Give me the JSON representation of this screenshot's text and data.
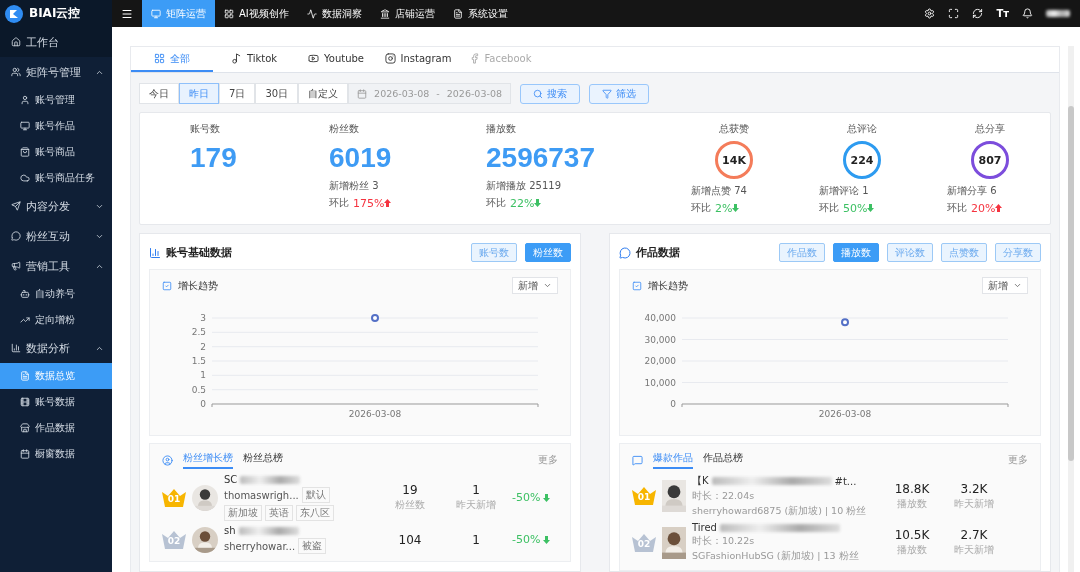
{
  "brand": {
    "name": "BIAI云控"
  },
  "top_nav": [
    {
      "label": "矩阵运营",
      "selected": true
    },
    {
      "label": "AI视频创作",
      "selected": false
    },
    {
      "label": "数据洞察",
      "selected": false
    },
    {
      "label": "店铺运营",
      "selected": false
    },
    {
      "label": "系统设置",
      "selected": false
    }
  ],
  "top_actions": {
    "font_button": "Tт"
  },
  "sidebar": [
    {
      "label": "工作台",
      "kind": "top",
      "selected": false
    },
    {
      "label": "矩阵号管理",
      "kind": "group",
      "expanded": true,
      "children": [
        {
          "label": "账号管理",
          "selected": false
        },
        {
          "label": "账号作品",
          "selected": false
        },
        {
          "label": "账号商品",
          "selected": false
        },
        {
          "label": "账号商品任务",
          "selected": false
        }
      ]
    },
    {
      "label": "内容分发",
      "kind": "group",
      "expanded": false
    },
    {
      "label": "粉丝互动",
      "kind": "group",
      "expanded": false
    },
    {
      "label": "营销工具",
      "kind": "group",
      "expanded": true,
      "children": [
        {
          "label": "自动养号",
          "selected": false
        },
        {
          "label": "定向增粉",
          "selected": false
        }
      ]
    },
    {
      "label": "数据分析",
      "kind": "group",
      "expanded": true,
      "children": [
        {
          "label": "数据总览",
          "selected": true
        },
        {
          "label": "账号数据",
          "selected": false
        },
        {
          "label": "作品数据",
          "selected": false
        },
        {
          "label": "橱窗数据",
          "selected": false
        }
      ]
    }
  ],
  "platform_tabs": [
    {
      "label": "全部",
      "selected": true,
      "disabled": false
    },
    {
      "label": "Tiktok",
      "selected": false,
      "disabled": false
    },
    {
      "label": "Youtube",
      "selected": false,
      "disabled": false
    },
    {
      "label": "Instagram",
      "selected": false,
      "disabled": false
    },
    {
      "label": "Facebook",
      "selected": false,
      "disabled": true
    }
  ],
  "date_filters": [
    {
      "label": "今日",
      "selected": false
    },
    {
      "label": "昨日",
      "selected": true
    },
    {
      "label": "7日",
      "selected": false
    },
    {
      "label": "30日",
      "selected": false
    },
    {
      "label": "自定义",
      "selected": false
    }
  ],
  "date_range": {
    "start": "2026-03-08",
    "separator": "-",
    "end": "2026-03-08"
  },
  "search_button": "搜索",
  "filter_button": "筛选",
  "stats": [
    {
      "kind": "number",
      "title": "账号数",
      "value": "179"
    },
    {
      "kind": "number",
      "title": "粉丝数",
      "value": "6019",
      "sub": "新增粉丝 3",
      "ratio_label": "环比",
      "ratio": "175%",
      "rising": true
    },
    {
      "kind": "number",
      "title": "播放数",
      "value": "2596737",
      "sub": "新增播放 25119",
      "ratio_label": "环比",
      "ratio": "22%",
      "rising": false
    },
    {
      "kind": "ring",
      "title": "总获赞",
      "value": "14K",
      "color": "#f47c5a",
      "sub": "新增点赞 74",
      "ratio_label": "环比",
      "ratio": "2%",
      "rising": false
    },
    {
      "kind": "ring",
      "title": "总评论",
      "value": "224",
      "color": "#2d9bf0",
      "sub": "新增评论 1",
      "ratio_label": "环比",
      "ratio": "50%",
      "rising": false
    },
    {
      "kind": "ring",
      "title": "总分享",
      "value": "807",
      "color": "#7c4ddc",
      "sub": "新增分享 6",
      "ratio_label": "环比",
      "ratio": "20%",
      "rising": true
    }
  ],
  "panels": [
    {
      "title": "账号基础数据",
      "buttons": [
        {
          "label": "账号数",
          "selected": false
        },
        {
          "label": "粉丝数",
          "selected": true
        }
      ],
      "trend": {
        "title": "增长趋势",
        "dropdown": "新增",
        "chart_data": {
          "type": "line",
          "grid": true,
          "categories": [
            "2026-03-08"
          ],
          "series": [
            {
              "color": "#5470c6",
              "marker": "circle",
              "values": [
                3
              ]
            }
          ],
          "ylim": [
            0,
            3
          ],
          "yticks": [
            0,
            0.5,
            1,
            1.5,
            2,
            2.5,
            3
          ]
        }
      },
      "ranking": {
        "tabs": [
          {
            "label": "粉丝增长榜",
            "selected": true
          },
          {
            "label": "粉丝总榜",
            "selected": false
          }
        ],
        "more": "更多",
        "kind": "account",
        "rows": [
          {
            "rank": "01",
            "name": "SC",
            "handle": "thomaswrigh...",
            "tags": [
              "默认"
            ],
            "extra_tags": [
              "新加坡",
              "英语",
              "东八区"
            ],
            "metric_1": "19",
            "metric_1_label": "粉丝数",
            "metric_2": "1",
            "metric_2_label": "昨天新增",
            "change": "-50%",
            "rising": false
          },
          {
            "rank": "02",
            "name": "sh",
            "handle": "sherryhowar...",
            "tags": [
              "被盗"
            ],
            "metric_1": "104",
            "metric_2": "1",
            "change": "-50%",
            "rising": false
          }
        ]
      }
    },
    {
      "title": "作品数据",
      "buttons": [
        {
          "label": "作品数",
          "selected": false
        },
        {
          "label": "播放数",
          "selected": true
        },
        {
          "label": "评论数",
          "selected": false
        },
        {
          "label": "点赞数",
          "selected": false
        },
        {
          "label": "分享数",
          "selected": false
        }
      ],
      "trend": {
        "title": "增长趋势",
        "dropdown": "新增",
        "chart_data": {
          "type": "line",
          "grid": true,
          "categories": [
            "2026-03-08"
          ],
          "series": [
            {
              "color": "#5470c6",
              "marker": "circle",
              "values": [
                38000
              ]
            }
          ],
          "ylim": [
            0,
            40000
          ],
          "yticks": [
            {
              "value": 0,
              "label": "0"
            },
            {
              "value": 10000,
              "label": "10,000"
            },
            {
              "value": 20000,
              "label": "20,000"
            },
            {
              "value": 30000,
              "label": "30,000"
            },
            {
              "value": 40000,
              "label": "40,000"
            }
          ]
        }
      },
      "ranking": {
        "tabs": [
          {
            "label": "爆款作品",
            "selected": true
          },
          {
            "label": "作品总榜",
            "selected": false
          }
        ],
        "more": "更多",
        "kind": "work",
        "rows": [
          {
            "rank": "01",
            "name": "【K",
            "name_end": "#t...",
            "duration": "时长：22.04s",
            "author": "sherryhoward6875 (新加坡) | 10 粉丝",
            "metric_1": "18.8K",
            "metric_1_label": "播放数",
            "metric_2": "3.2K",
            "metric_2_label": "昨天新增"
          },
          {
            "rank": "02",
            "name": "Tired",
            "duration": "时长：10.22s",
            "author": "SGFashionHubSG (新加坡) | 13 粉丝",
            "metric_1": "10.5K",
            "metric_1_label": "播放数",
            "metric_2": "2.7K",
            "metric_2_label": "昨天新增"
          }
        ]
      }
    }
  ]
}
